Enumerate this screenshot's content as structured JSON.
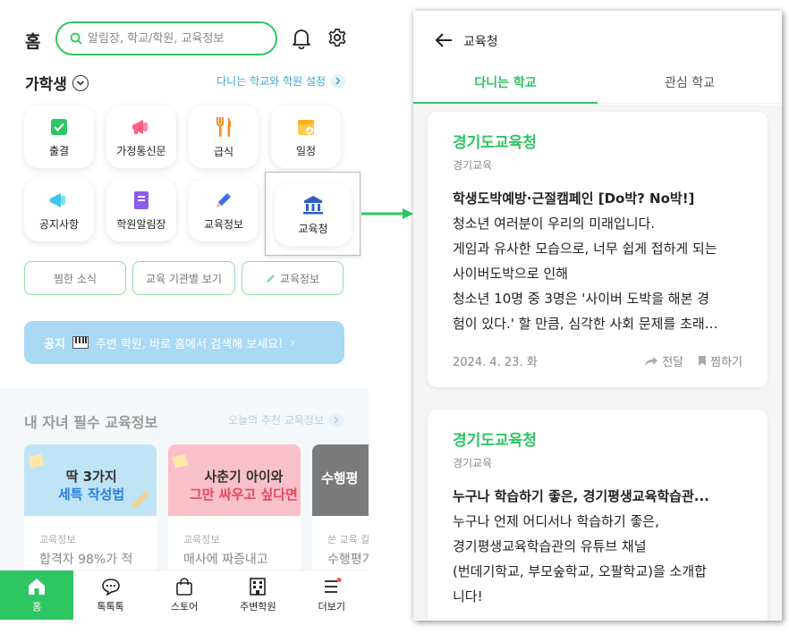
{
  "left": {
    "header": {
      "title": "홈",
      "search_placeholder": "알림장, 학교/학원, 교육정보"
    },
    "child": {
      "name": "가학생",
      "setting_link": "다니는 학교와 학원 설정"
    },
    "menu": {
      "items": [
        {
          "label": "출결",
          "icon": "attendance-icon"
        },
        {
          "label": "가정통신문",
          "icon": "megaphone-icon"
        },
        {
          "label": "급식",
          "icon": "meal-icon"
        },
        {
          "label": "일정",
          "icon": "calendar-icon"
        },
        {
          "label": "공지사항",
          "icon": "announce-icon"
        },
        {
          "label": "학원알림장",
          "icon": "notebook-icon"
        },
        {
          "label": "교육정보",
          "icon": "pencil-icon"
        },
        {
          "label": "교육청",
          "icon": "office-building-icon"
        }
      ]
    },
    "chips": [
      "찜한 소식",
      "교육 기관별 보기",
      "교육정보"
    ],
    "notice": {
      "tag": "공지",
      "text": "주변 학원, 바로 홈에서 검색해 보세요!"
    },
    "info_section": {
      "title": "내 자녀 필수 교육정보",
      "link": "오늘의 추천 교육정보",
      "cards": [
        {
          "image_title_1": "딱 3가지",
          "image_title_2": "세특 작성법",
          "category": "교육정보",
          "desc": "합격자 98%가 적"
        },
        {
          "image_title_1": "사춘기 아이와",
          "image_title_2": "그만 싸우고 싶다면",
          "category": "교육정보",
          "desc": "매사에 짜증내고"
        },
        {
          "image_title_1": "수행평",
          "image_title_2": "",
          "category": "쓴 교육 칼",
          "desc": "수행평가"
        }
      ]
    },
    "bottom_nav": [
      {
        "label": "홈",
        "icon": "home-icon"
      },
      {
        "label": "톡톡톡",
        "icon": "chat-icon"
      },
      {
        "label": "스토어",
        "icon": "shopping-bag-icon"
      },
      {
        "label": "주변학원",
        "icon": "grid-building-icon"
      },
      {
        "label": "더보기",
        "icon": "menu-icon"
      }
    ]
  },
  "right": {
    "header": {
      "title": "교육청"
    },
    "tabs": [
      "다니는 학교",
      "관심 학교"
    ],
    "posts": [
      {
        "org": "경기도교육청",
        "sub": "경기교육",
        "title": "학생도박예방·근절캠페인 [Do박? No박!]",
        "lines": [
          "청소년 여러분이 우리의 미래입니다.",
          "게임과 유사한 모습으로, 너무 쉽게 접하게 되는",
          "사이버도박으로 인해",
          "청소년 10명 중 3명은 '사이버 도박을 해본 경",
          "험이 있다.' 할 만큼, 심각한 사회 문제를 초래…"
        ],
        "date": "2024. 4. 23. 화",
        "share": "전달",
        "bookmark": "찜하기"
      },
      {
        "org": "경기도교육청",
        "sub": "경기교육",
        "title": "누구나 학습하기 좋은, 경기평생교육학습관...",
        "lines": [
          "누구나 언제 어디서나 학습하기 좋은,",
          "경기평생교육학습관의 유튜브 채널",
          "(번데기학교, 부모숲학교, 오팔학교)을 소개합",
          "니다!"
        ]
      }
    ]
  }
}
